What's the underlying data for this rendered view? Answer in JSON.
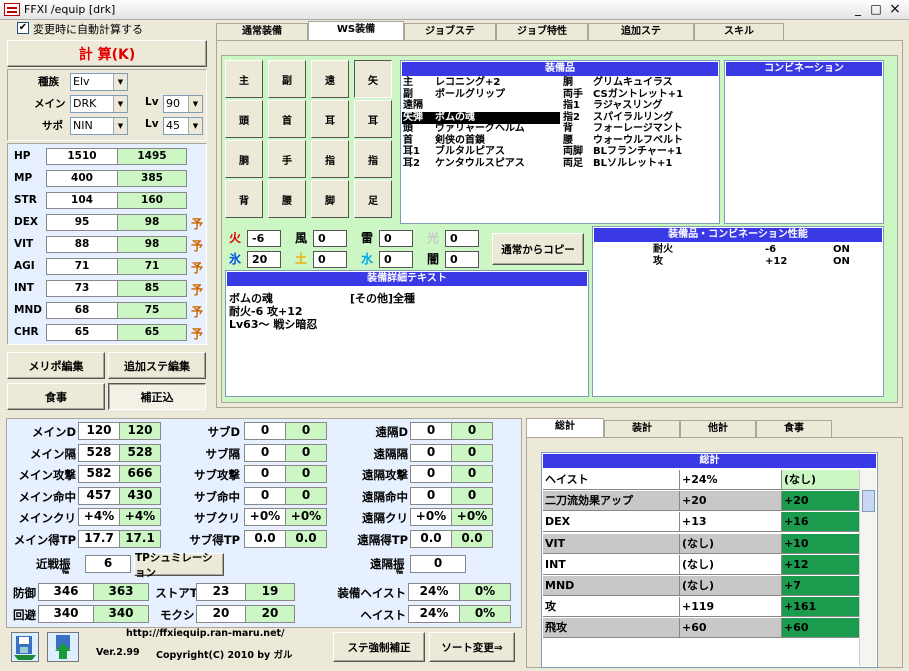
{
  "window": {
    "title": "FFXI /equip [drk]",
    "min": "_",
    "max": "□",
    "close": "×"
  },
  "auto_calc_label": "変更時に自動計算する",
  "calc_button": "計 算(K)",
  "selectors": {
    "race_label": "種族",
    "race": "Elv",
    "main_label": "メイン",
    "main": "DRK",
    "sub_label": "サポ",
    "sub": "NIN",
    "lv_label": "Lv",
    "main_lv": "90",
    "sub_lv": "45"
  },
  "stats": [
    {
      "name": "HP",
      "base": "1510",
      "total": "1495",
      "yo": ""
    },
    {
      "name": "MP",
      "base": "400",
      "total": "385",
      "yo": ""
    },
    {
      "name": "STR",
      "base": "104",
      "total": "160",
      "yo": ""
    },
    {
      "name": "DEX",
      "base": "95",
      "total": "98",
      "yo": "予"
    },
    {
      "name": "VIT",
      "base": "88",
      "total": "98",
      "yo": "予"
    },
    {
      "name": "AGI",
      "base": "71",
      "total": "71",
      "yo": "予"
    },
    {
      "name": "INT",
      "base": "73",
      "total": "85",
      "yo": "予"
    },
    {
      "name": "MND",
      "base": "68",
      "total": "75",
      "yo": "予"
    },
    {
      "name": "CHR",
      "base": "65",
      "total": "65",
      "yo": "予"
    }
  ],
  "left_buttons": {
    "merit": "メリポ編集",
    "addstat": "追加ステ編集",
    "food": "食事",
    "correct": "補正込"
  },
  "tabs": [
    "通常装備",
    "WS装備",
    "ジョブステ",
    "ジョブ特性",
    "追加ステ",
    "スキル"
  ],
  "slots": [
    "主",
    "副",
    "遠",
    "矢",
    "頭",
    "首",
    "耳",
    "耳",
    "胴",
    "手",
    "指",
    "指",
    "背",
    "腰",
    "脚",
    "足"
  ],
  "equip_list": {
    "header": "装備品",
    "left": [
      [
        "主",
        "レコニング+2"
      ],
      [
        "副",
        "ポールグリップ"
      ],
      [
        "遠隔",
        ""
      ],
      [
        "矢弾",
        "ボムの魂"
      ],
      [
        "頭",
        "ヴァリャーグヘルム"
      ],
      [
        "首",
        "剣侠の首鎖"
      ],
      [
        "耳1",
        "ブルタルピアス"
      ],
      [
        "耳2",
        "ケンタウルスピアス"
      ]
    ],
    "right": [
      [
        "胴",
        "グリムキュイラス"
      ],
      [
        "両手",
        "CSガントレット+1"
      ],
      [
        "指1",
        "ラジャスリング"
      ],
      [
        "指2",
        "スパイラルリング"
      ],
      [
        "背",
        "フォーレージマント"
      ],
      [
        "腰",
        "ウォーウルフベルト"
      ],
      [
        "両脚",
        "BLフランチャー+1"
      ],
      [
        "両足",
        "BLソルレット+1"
      ]
    ]
  },
  "combination": {
    "header": "コンビネーション"
  },
  "elements": [
    {
      "name": "火",
      "value": "-6",
      "color": "#e00000"
    },
    {
      "name": "風",
      "value": "0",
      "color": "#000000"
    },
    {
      "name": "雷",
      "value": "0",
      "color": "#000000"
    },
    {
      "name": "光",
      "value": "0",
      "color": "#c8c8c8"
    },
    {
      "name": "氷",
      "value": "20",
      "color": "#0050e0"
    },
    {
      "name": "土",
      "value": "0",
      "color": "#e8b000"
    },
    {
      "name": "水",
      "value": "0",
      "color": "#00a8e8"
    },
    {
      "name": "闇",
      "value": "0",
      "color": "#000000"
    }
  ],
  "copy_button": "通常からコピー",
  "combo_perf": {
    "header": "装備品・コンビネーション性能",
    "rows": [
      [
        "耐火",
        "-6",
        "ON"
      ],
      [
        "攻",
        "+12",
        "ON"
      ]
    ]
  },
  "detail": {
    "header": "装備詳細テキスト",
    "lines": [
      "ボムの魂　　　　　　　[その他]全種",
      "耐火-6 攻+12",
      "Lv63～ 戦シ暗忍"
    ]
  },
  "bottom": {
    "main_rows": [
      [
        "メインD",
        "120",
        "120"
      ],
      [
        "メイン隔",
        "528",
        "528"
      ],
      [
        "メイン攻撃",
        "582",
        "666"
      ],
      [
        "メイン命中",
        "457",
        "430"
      ],
      [
        "メインクリ",
        "+4%",
        "+4%"
      ],
      [
        "メイン得TP",
        "17.7",
        "17.1"
      ]
    ],
    "sub_rows": [
      [
        "サブD",
        "0",
        "0"
      ],
      [
        "サブ隔",
        "0",
        "0"
      ],
      [
        "サブ攻撃",
        "0",
        "0"
      ],
      [
        "サブ命中",
        "0",
        "0"
      ],
      [
        "サブクリ",
        "+0%",
        "+0%"
      ],
      [
        "サブ得TP",
        "0.0",
        "0.0"
      ]
    ],
    "ranged_rows": [
      [
        "遠隔D",
        "0",
        "0"
      ],
      [
        "遠隔隔",
        "0",
        "0"
      ],
      [
        "遠隔攻撃",
        "0",
        "0"
      ],
      [
        "遠隔命中",
        "0",
        "0"
      ],
      [
        "遠隔クリ",
        "+0%",
        "+0%"
      ],
      [
        "遠隔得TP",
        "0.0",
        "0.0"
      ]
    ],
    "melee_skill_label": "近戦振",
    "melee_skill_sub": "幅",
    "melee_skill": "6",
    "tpsim": "TPシュミレーション",
    "ranged_skill_label": "遠隔振",
    "ranged_skill_sub": "幅",
    "ranged_skill": "0",
    "def": [
      "防御",
      "346",
      "363"
    ],
    "eva": [
      "回避",
      "340",
      "340"
    ],
    "storetp": [
      "ストアTP",
      "23",
      "19"
    ],
    "mokusha": [
      "モクシャ",
      "20",
      "20"
    ],
    "equip_haste": [
      "装備ヘイスト",
      "24%",
      "0%"
    ],
    "haste": [
      "ヘイスト",
      "24%",
      "0%"
    ]
  },
  "footer": {
    "url": "http://ffxiequip.ran-maru.net/",
    "version": "Ver.2.99",
    "copyright": "Copyright(C) 2010 by ガル",
    "force_btn": "ステ強制補正",
    "sort_btn": "ソート変更⇒"
  },
  "right_tabs": [
    "総計",
    "装計",
    "他計",
    "食事"
  ],
  "total": {
    "header": "総計",
    "rows": [
      [
        "ヘイスト",
        "+24%",
        "(なし)"
      ],
      [
        "二刀流効果アップ",
        "+20",
        "+20"
      ],
      [
        "DEX",
        "+13",
        "+16"
      ],
      [
        "VIT",
        "(なし)",
        "+10"
      ],
      [
        "INT",
        "(なし)",
        "+12"
      ],
      [
        "MND",
        "(なし)",
        "+7"
      ],
      [
        "攻",
        "+119",
        "+161"
      ],
      [
        "飛攻",
        "+60",
        "+60"
      ]
    ]
  },
  "colors": {
    "green_cell": "#ccf7c5",
    "dark_green": "#1a9b4d",
    "header_blue": "#3939e6",
    "light_blue_panel": "#e6f0ff"
  }
}
